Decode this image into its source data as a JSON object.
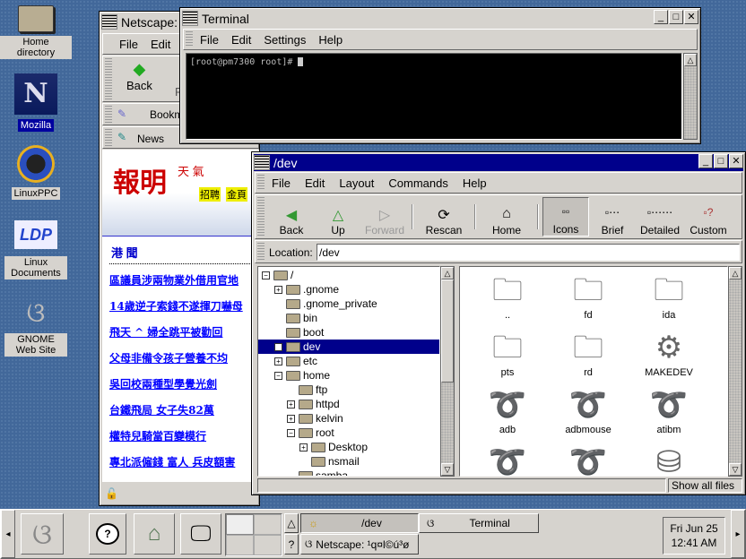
{
  "desktop_icons": [
    {
      "label": "Home directory",
      "icon": "folder-icon"
    },
    {
      "label": "Mozilla",
      "icon": "mozilla-icon"
    },
    {
      "label": "LinuxPPC",
      "icon": "linuxppc-icon"
    },
    {
      "label": "Linux Documents",
      "icon": "ldp-icon",
      "logo_text": "LDP"
    },
    {
      "label": "GNOME Web Site",
      "icon": "gnome-foot-icon"
    }
  ],
  "netscape": {
    "title": "Netscape:",
    "menu": [
      "File",
      "Edit"
    ],
    "toolbar": {
      "back": "Back",
      "forward_partial": "F"
    },
    "bookmarks": "Bookm",
    "news": "News",
    "page": {
      "logo_text": "報明",
      "banner": [
        "天  氣",
        "招聘",
        "金頁"
      ],
      "section": "港 聞",
      "headlines": [
        "區議員涉兩物業外借用官地",
        "14歲逆子索錢不遂揮刀嚇母",
        "飛天 ^ 婦全跳平被勸回",
        "父母非備令孩子營養不均",
        "吳回校兩種型學覺光劍",
        "台鐵飛局 女子失82萬",
        "權特兒騎當百變模行",
        "專北派僱錢 富人 兵皮額害"
      ]
    }
  },
  "terminal": {
    "title": "Terminal",
    "menu": [
      "File",
      "Edit",
      "Settings",
      "Help"
    ],
    "prompt": "[root@pm7300 root]# "
  },
  "filemanager": {
    "title": "/dev",
    "menu": [
      "File",
      "Edit",
      "Layout",
      "Commands",
      "Help"
    ],
    "toolbar": [
      {
        "label": "Back",
        "icon": "back-arrow-icon",
        "glyph": "◀",
        "disabled": false
      },
      {
        "label": "Up",
        "icon": "up-arrow-icon",
        "glyph": "△",
        "disabled": false
      },
      {
        "label": "Forward",
        "icon": "forward-arrow-icon",
        "glyph": "▷",
        "disabled": true
      },
      {
        "label": "Rescan",
        "icon": "rescan-icon",
        "glyph": "⟳",
        "disabled": false
      },
      {
        "label": "Home",
        "icon": "home-icon",
        "glyph": "⌂",
        "disabled": false
      },
      {
        "label": "Icons",
        "icon": "icons-view-icon",
        "glyph": "▫▫",
        "disabled": false,
        "pressed": true
      },
      {
        "label": "Brief",
        "icon": "brief-view-icon",
        "glyph": "▫⋯",
        "disabled": false
      },
      {
        "label": "Detailed",
        "icon": "detailed-view-icon",
        "glyph": "▫⋯⋯",
        "disabled": false
      },
      {
        "label": "Custom",
        "icon": "custom-view-icon",
        "glyph": "▫?",
        "disabled": false
      }
    ],
    "location_label": "Location:",
    "location_value": "/dev",
    "tree": [
      {
        "label": "/",
        "depth": 0,
        "exp": "−",
        "open": true
      },
      {
        "label": ".gnome",
        "depth": 1,
        "exp": "+"
      },
      {
        "label": ".gnome_private",
        "depth": 1,
        "exp": ""
      },
      {
        "label": "bin",
        "depth": 1,
        "exp": ""
      },
      {
        "label": "boot",
        "depth": 1,
        "exp": ""
      },
      {
        "label": "dev",
        "depth": 1,
        "exp": "+",
        "selected": true
      },
      {
        "label": "etc",
        "depth": 1,
        "exp": "+"
      },
      {
        "label": "home",
        "depth": 1,
        "exp": "−",
        "open": true
      },
      {
        "label": "ftp",
        "depth": 2,
        "exp": ""
      },
      {
        "label": "httpd",
        "depth": 2,
        "exp": "+"
      },
      {
        "label": "kelvin",
        "depth": 2,
        "exp": "+"
      },
      {
        "label": "root",
        "depth": 2,
        "exp": "−",
        "open": true
      },
      {
        "label": "Desktop",
        "depth": 3,
        "exp": "+"
      },
      {
        "label": "nsmail",
        "depth": 3,
        "exp": ""
      },
      {
        "label": "samba",
        "depth": 2,
        "exp": ""
      }
    ],
    "files": [
      {
        "name": "..",
        "icon": "folder-icon",
        "glyph": "🗀"
      },
      {
        "name": "fd",
        "icon": "folder-link-icon",
        "glyph": "🗀"
      },
      {
        "name": "ida",
        "icon": "folder-icon",
        "glyph": "🗀"
      },
      {
        "name": "pts",
        "icon": "folder-icon",
        "glyph": "🗀"
      },
      {
        "name": "rd",
        "icon": "folder-icon",
        "glyph": "🗀"
      },
      {
        "name": "MAKEDEV",
        "icon": "piston-executable-icon",
        "glyph": "⚙"
      },
      {
        "name": "adb",
        "icon": "char-device-icon",
        "glyph": "➰"
      },
      {
        "name": "adbmouse",
        "icon": "char-device-icon",
        "glyph": "➰"
      },
      {
        "name": "atibm",
        "icon": "char-device-icon",
        "glyph": "➰"
      },
      {
        "name": "",
        "icon": "char-device-icon",
        "glyph": "➰"
      },
      {
        "name": "",
        "icon": "char-device-icon",
        "glyph": "➰"
      },
      {
        "name": "",
        "icon": "block-device-icon",
        "glyph": "⛁"
      }
    ],
    "status": "Show all files"
  },
  "panel": {
    "tasks": [
      {
        "label": "/dev",
        "active": true
      },
      {
        "label": "Terminal",
        "active": false
      },
      {
        "label": "Netscape: ¹q¤l©ú³ø",
        "active": false
      }
    ],
    "clock_date": "Fri Jun 25",
    "clock_time": "12:41 AM",
    "help_glyph": "?",
    "up_glyph": "△"
  }
}
